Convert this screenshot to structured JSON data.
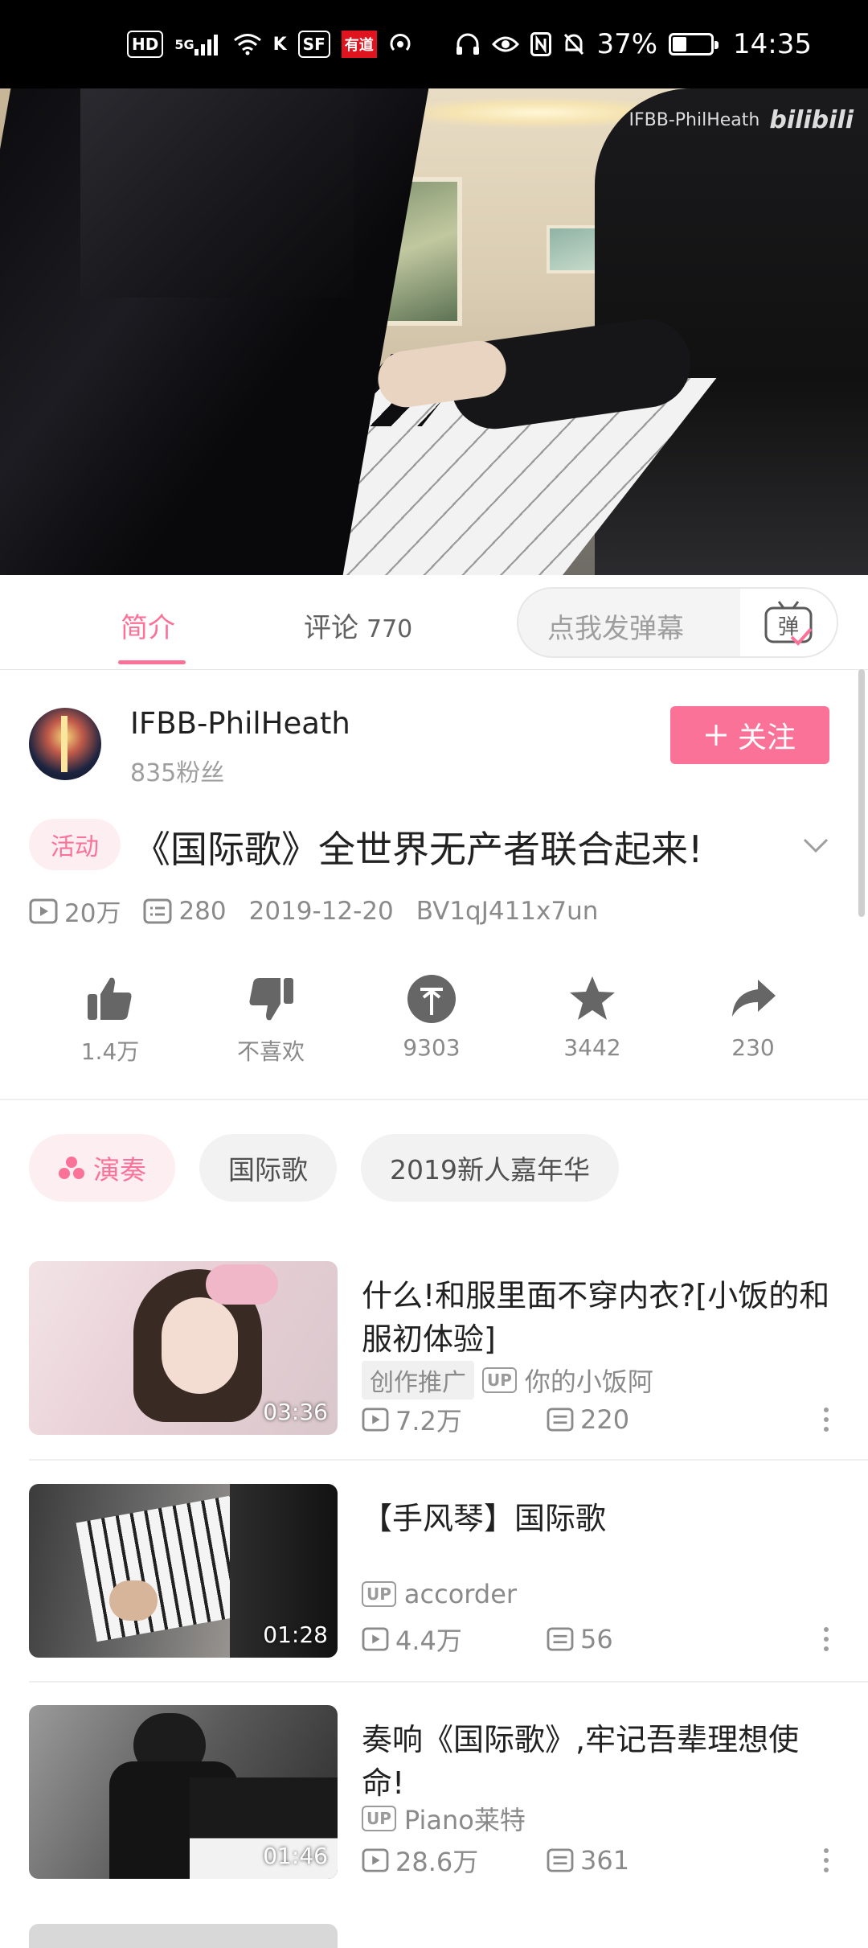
{
  "status_bar": {
    "left_icons": [
      "HD",
      "5G",
      "signal",
      "wifi",
      "K",
      "SF",
      "有道",
      "hotspot"
    ],
    "battery": "37%",
    "battery_level": 0.37,
    "time": "14:35"
  },
  "video": {
    "watermark_user": "IFBB-PhilHeath",
    "watermark_logo": "bilibili"
  },
  "tabs": {
    "intro": "简介",
    "comments": "评论",
    "comments_count": "770",
    "danmaku_placeholder": "点我发弹幕",
    "danmaku_icon_char": "弹"
  },
  "uploader": {
    "name": "IFBB-PhilHeath",
    "fans": "835粉丝",
    "follow_label": "关注"
  },
  "title_section": {
    "tag": "活动",
    "title": "《国际歌》全世界无产者联合起来!"
  },
  "meta": {
    "views": "20万",
    "danmaku": "280",
    "date": "2019-12-20",
    "bvid": "BV1qJ411x7un"
  },
  "actions": [
    {
      "icon": "thumbs-up-icon",
      "label": "1.4万"
    },
    {
      "icon": "thumbs-down-icon",
      "label": "不喜欢"
    },
    {
      "icon": "coin-icon",
      "label": "9303"
    },
    {
      "icon": "star-icon",
      "label": "3442"
    },
    {
      "icon": "share-icon",
      "label": "230"
    }
  ],
  "tags": [
    "演奏",
    "国际歌",
    "2019新人嘉年华"
  ],
  "recommendations": [
    {
      "title": "什么!和服里面不穿内衣?[小饭的和服初体验]",
      "promo": "创作推广",
      "up": "你的小饭阿",
      "views": "7.2万",
      "danmaku": "220",
      "duration": "03:36"
    },
    {
      "title": "【手风琴】国际歌",
      "promo": "",
      "up": "accorder",
      "views": "4.4万",
      "danmaku": "56",
      "duration": "01:28"
    },
    {
      "title": "奏响《国际歌》,牢记吾辈理想使命!",
      "promo": "",
      "up": "Piano莱特",
      "views": "28.6万",
      "danmaku": "361",
      "duration": "01:46"
    }
  ],
  "colors": {
    "accent": "#fb7299",
    "text": "#212121",
    "muted": "#8a8a8a"
  }
}
